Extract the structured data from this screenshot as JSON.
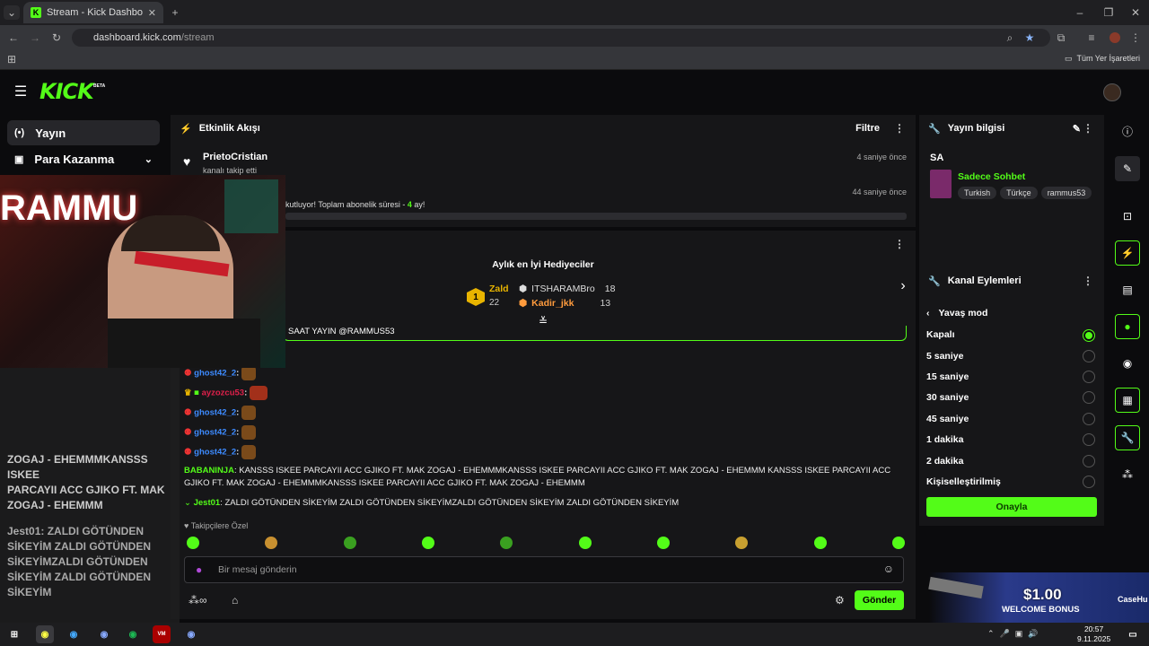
{
  "browser": {
    "tab_title": "Stream - Kick Dashboard",
    "url_domain": "dashboard.kick.com",
    "url_path": "/stream",
    "bookmarks_label": "Tüm Yer İşaretleri"
  },
  "app": {
    "logo": "KICK",
    "logo_badge": "BETA"
  },
  "nav": {
    "items": [
      {
        "label": "Yayın",
        "icon": "broadcast-icon"
      },
      {
        "label": "Para Kazanma",
        "icon": "money-icon"
      }
    ]
  },
  "activity": {
    "title": "Etkinlik Akışı",
    "filter": "Filtre",
    "events": [
      {
        "user": "PrietoCristian",
        "text": "kanalı takip etti",
        "time": "4 saniye önce"
      },
      {
        "text_prefix": "kutluyor! Toplam abonelik süresi - ",
        "months": "4",
        "text_suffix": " ay!",
        "time": "44 saniye önce"
      }
    ]
  },
  "gifters": {
    "title": "Aylık en İyi Hediyeciler",
    "top": {
      "rank": "1",
      "name": "Zald",
      "count": "22"
    },
    "others": [
      {
        "name": "ITSHARAMBro",
        "count": "18"
      },
      {
        "name": "Kadir_jkk",
        "count": "13"
      }
    ]
  },
  "chat": {
    "pinned": "SAAT YAYIN @RAMMUS53",
    "messages": [
      {
        "user": "ghost42_2",
        "color": "#3d8bff"
      },
      {
        "user": "ayzozcu53",
        "color": "#e0204b"
      },
      {
        "user": "ghost42_2",
        "color": "#3d8bff"
      },
      {
        "user": "ghost42_2",
        "color": "#3d8bff"
      },
      {
        "user": "ghost42_2",
        "color": "#3d8bff"
      }
    ],
    "long_msg": {
      "user": "BABANINJA",
      "text": "KANSSS ISKEE PARCAYII ACC GJIKO FT. MAK ZOGAJ - EHEMMMKANSSS ISKEE PARCAYII ACC GJIKO FT. MAK ZOGAJ - EHEMMM KANSSS ISKEE PARCAYII ACC GJIKO FT. MAK ZOGAJ - EHEMMMKANSSS ISKEE PARCAYII ACC GJIKO FT. MAK ZOGAJ - EHEMMM"
    },
    "jest_msg": {
      "user": "Jest01",
      "text": "ZALDI GÖTÜNDEN SİKEYİM ZALDI GÖTÜNDEN SİKEYİMZALDI GÖTÜNDEN SİKEYİM ZALDI GÖTÜNDEN SİKEYİM"
    },
    "followers_only": "Takipçilere Özel",
    "input_placeholder": "Bir mesaj gönderin",
    "send": "Gönder"
  },
  "overlay": {
    "line1": "ZOGAJ - EHEMMMKANSSS ISKEE",
    "line2": "PARCAYII ACC GJIKO FT. MAK",
    "line3": "ZOGAJ - EHEMMM",
    "line4": "Jest01: ZALDI GÖTÜNDEN",
    "line5": "SİKEYİM ZALDI GÖTÜNDEN",
    "line6": "SİKEYİMZALDI GÖTÜNDEN",
    "line7": "SİKEYİM ZALDI GÖTÜNDEN",
    "line8": "SİKEYİM",
    "cam_text": "RAMMU"
  },
  "stream_info": {
    "title": "Yayın bilgisi",
    "stream_title": "SA",
    "category": "Sadece Sohbet",
    "tags": [
      "Turkish",
      "Türkçe",
      "rammus53"
    ]
  },
  "channel_actions": {
    "title": "Kanal Eylemleri",
    "slow_mode": "Yavaş mod",
    "options": [
      "Kapalı",
      "5 saniye",
      "15 saniye",
      "30 saniye",
      "45 saniye",
      "1 dakika",
      "2 dakika",
      "Kişiselleştirilmiş"
    ],
    "selected": "Kapalı",
    "confirm": "Onayla"
  },
  "ad": {
    "amount": "$1.00",
    "bonus": "WELCOME BONUS",
    "brand": "CaseHu"
  },
  "taskbar": {
    "time": "20:57",
    "date": "9.11.2025"
  },
  "colors": {
    "accent": "#53fc18",
    "panel": "#161618",
    "bg": "#0b0b0d"
  }
}
